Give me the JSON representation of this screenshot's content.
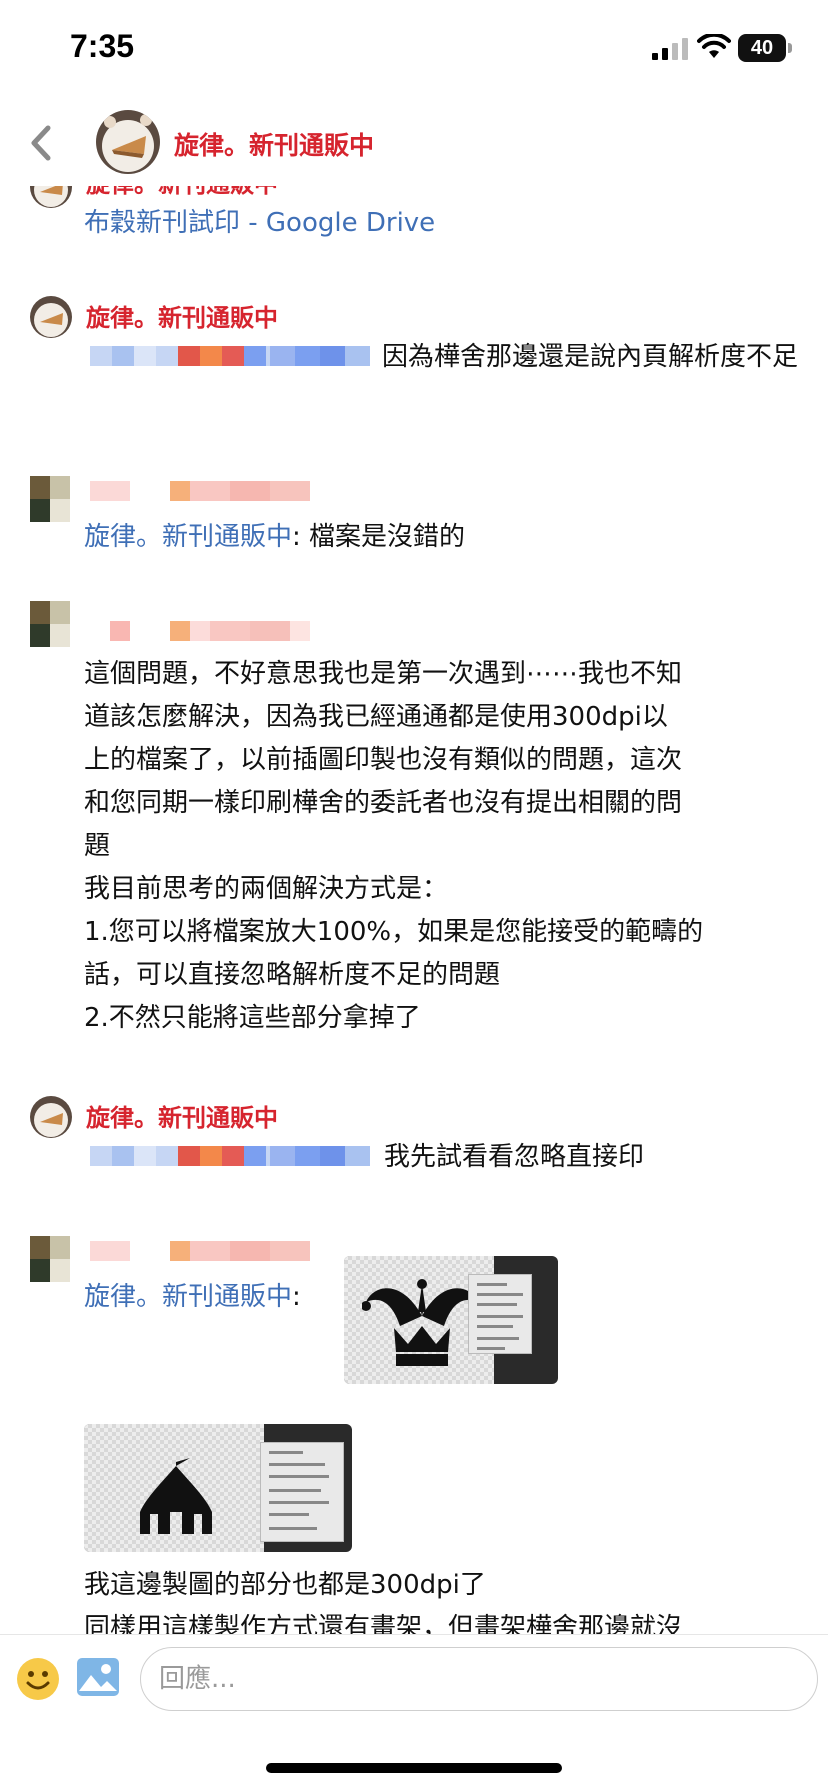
{
  "status_bar": {
    "time": "7:35",
    "battery": "40"
  },
  "header": {
    "title": "旋律。新刊通販中"
  },
  "messages": [
    {
      "sender": "旋律。新刊通販中",
      "link_text": "布穀新刊試印 - Google Drive"
    },
    {
      "sender": "旋律。新刊通販中",
      "text": "因為樺舍那邊還是說內頁解析度不足"
    },
    {
      "quote_name": "旋律。新刊通販中",
      "quote_sep": ": ",
      "quote_text": "檔案是沒錯的"
    },
    {
      "lines": [
        "這個問題，不好意思我也是第一次遇到⋯⋯我也不知",
        "道該怎麼解決，因為我已經通通都是使用300dpi以",
        "上的檔案了，以前插圖印製也沒有類似的問題，這次",
        "和您同期一樣印刷樺舍的委託者也沒有提出相關的問",
        "題",
        "我目前思考的兩個解決方式是：",
        "1.您可以將檔案放大100%，如果是您能接受的範疇的",
        "話，可以直接忽略解析度不足的問題",
        "2.不然只能將這些部分拿掉了"
      ]
    },
    {
      "sender": "旋律。新刊通販中",
      "text": "我先試看看忽略直接印"
    },
    {
      "quote_name": "旋律。新刊通販中",
      "quote_sep": ":",
      "lines": [
        "我這邊製圖的部分也都是300dpi了",
        "同樣用這樣製作方式還有畫架，但畫架樺舍那邊就沒"
      ]
    }
  ],
  "composer": {
    "placeholder": "回應..."
  },
  "icons": {
    "back": "chevron-left-icon",
    "emoji": "emoji-icon",
    "photo": "photo-icon",
    "signal": "signal-icon",
    "wifi": "wifi-icon",
    "battery": "battery-icon"
  },
  "colors": {
    "sender": "#d6242e",
    "link": "#3f6fb6",
    "emoji_yellow": "#f7c948",
    "photo_blue": "#7fb6e6"
  }
}
